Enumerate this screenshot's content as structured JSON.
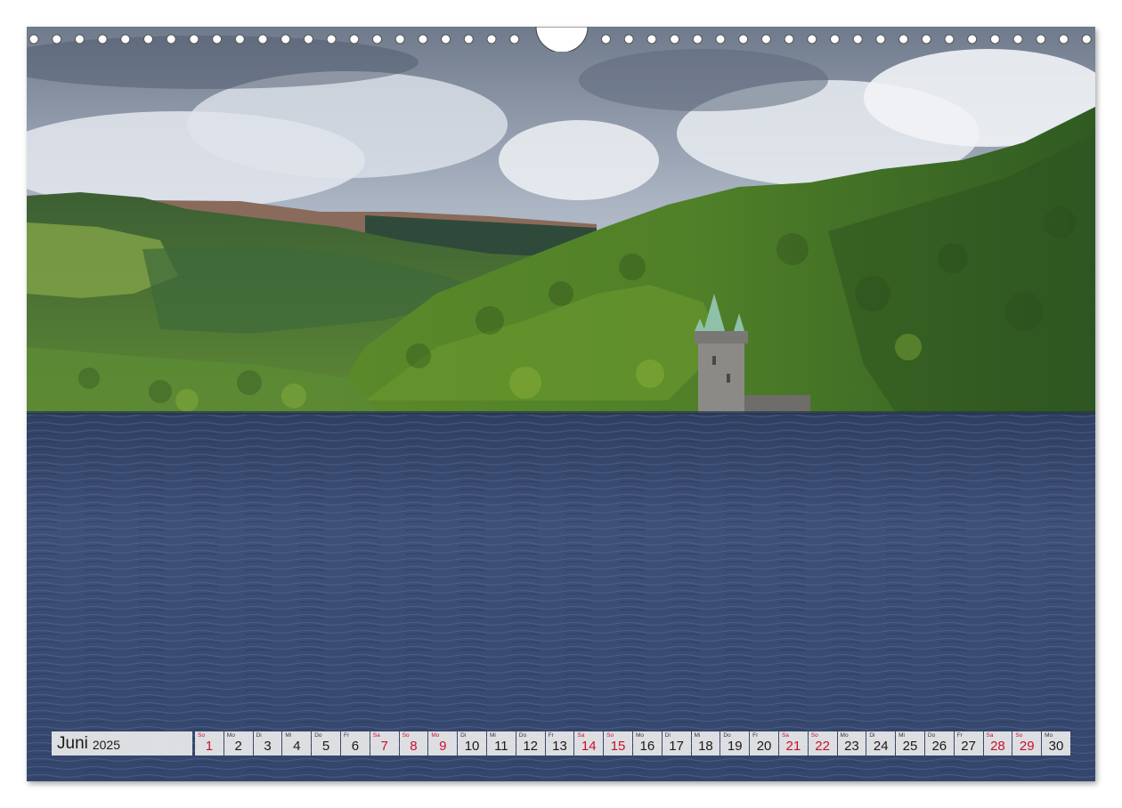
{
  "calendar": {
    "month": "Juni",
    "year": "2025",
    "days": [
      {
        "wd": "So",
        "d": "1",
        "we": true
      },
      {
        "wd": "Mo",
        "d": "2",
        "we": false
      },
      {
        "wd": "Di",
        "d": "3",
        "we": false
      },
      {
        "wd": "Mi",
        "d": "4",
        "we": false
      },
      {
        "wd": "Do",
        "d": "5",
        "we": false
      },
      {
        "wd": "Fr",
        "d": "6",
        "we": false
      },
      {
        "wd": "Sa",
        "d": "7",
        "we": true
      },
      {
        "wd": "So",
        "d": "8",
        "we": true
      },
      {
        "wd": "Mo",
        "d": "9",
        "we": true
      },
      {
        "wd": "Di",
        "d": "10",
        "we": false
      },
      {
        "wd": "Mi",
        "d": "11",
        "we": false
      },
      {
        "wd": "Do",
        "d": "12",
        "we": false
      },
      {
        "wd": "Fr",
        "d": "13",
        "we": false
      },
      {
        "wd": "Sa",
        "d": "14",
        "we": true
      },
      {
        "wd": "So",
        "d": "15",
        "we": true
      },
      {
        "wd": "Mo",
        "d": "16",
        "we": false
      },
      {
        "wd": "Di",
        "d": "17",
        "we": false
      },
      {
        "wd": "Mi",
        "d": "18",
        "we": false
      },
      {
        "wd": "Do",
        "d": "19",
        "we": false
      },
      {
        "wd": "Fr",
        "d": "20",
        "we": false
      },
      {
        "wd": "Sa",
        "d": "21",
        "we": true
      },
      {
        "wd": "So",
        "d": "22",
        "we": true
      },
      {
        "wd": "Mo",
        "d": "23",
        "we": false
      },
      {
        "wd": "Di",
        "d": "24",
        "we": false
      },
      {
        "wd": "Mi",
        "d": "25",
        "we": false
      },
      {
        "wd": "Do",
        "d": "26",
        "we": false
      },
      {
        "wd": "Fr",
        "d": "27",
        "we": false
      },
      {
        "wd": "Sa",
        "d": "28",
        "we": true
      },
      {
        "wd": "So",
        "d": "29",
        "we": true
      },
      {
        "wd": "Mo",
        "d": "30",
        "we": false
      }
    ]
  },
  "colors": {
    "sky": "#c9d2de",
    "cloud": "#eef1f5",
    "forest": "#3f6e2c",
    "lake": "#3f5279",
    "weekend": "#c8102e"
  }
}
